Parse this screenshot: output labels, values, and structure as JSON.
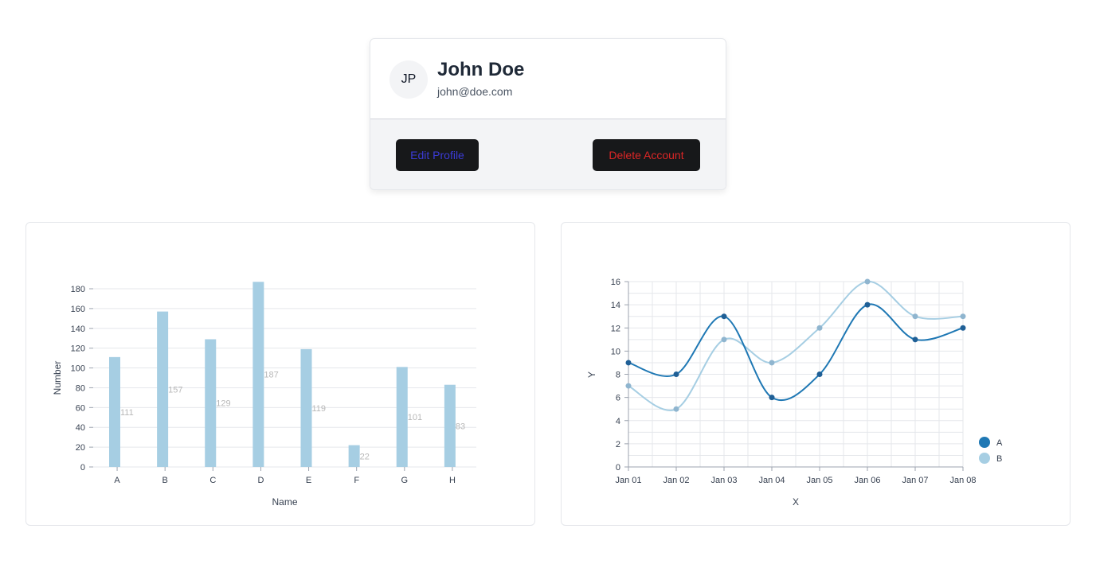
{
  "profile": {
    "initials": "JP",
    "name": "John Doe",
    "email": "john@doe.com",
    "edit_label": "Edit Profile",
    "delete_label": "Delete Account"
  },
  "colors": {
    "bar": "#a6cee3",
    "series_a": "#1f78b4",
    "series_b": "#a6cee3",
    "button_bg": "#17181a",
    "edit_text": "#3b3bd6",
    "delete_text": "#dc2626"
  },
  "chart_data": [
    {
      "type": "bar",
      "categories": [
        "A",
        "B",
        "C",
        "D",
        "E",
        "F",
        "G",
        "H"
      ],
      "values": [
        111,
        157,
        129,
        187,
        119,
        22,
        101,
        83
      ],
      "xlabel": "Name",
      "ylabel": "Number",
      "ylim": [
        0,
        180
      ],
      "yticks": [
        0,
        20,
        40,
        60,
        80,
        100,
        120,
        140,
        160,
        180
      ],
      "grid": "horizontal",
      "data_labels": true
    },
    {
      "type": "line",
      "x": [
        "Jan 01",
        "Jan 02",
        "Jan 03",
        "Jan 04",
        "Jan 05",
        "Jan 06",
        "Jan 07",
        "Jan 08"
      ],
      "series": [
        {
          "name": "A",
          "values": [
            9,
            8,
            13,
            6,
            8,
            14,
            11,
            12
          ]
        },
        {
          "name": "B",
          "values": [
            7,
            5,
            11,
            9,
            12,
            16,
            13,
            13
          ]
        }
      ],
      "xlabel": "X",
      "ylabel": "Y",
      "ylim": [
        0,
        16
      ],
      "yticks": [
        0,
        2,
        4,
        6,
        8,
        10,
        12,
        14,
        16
      ],
      "grid": "both",
      "legend": "bottom-right",
      "curve": "smooth"
    }
  ]
}
